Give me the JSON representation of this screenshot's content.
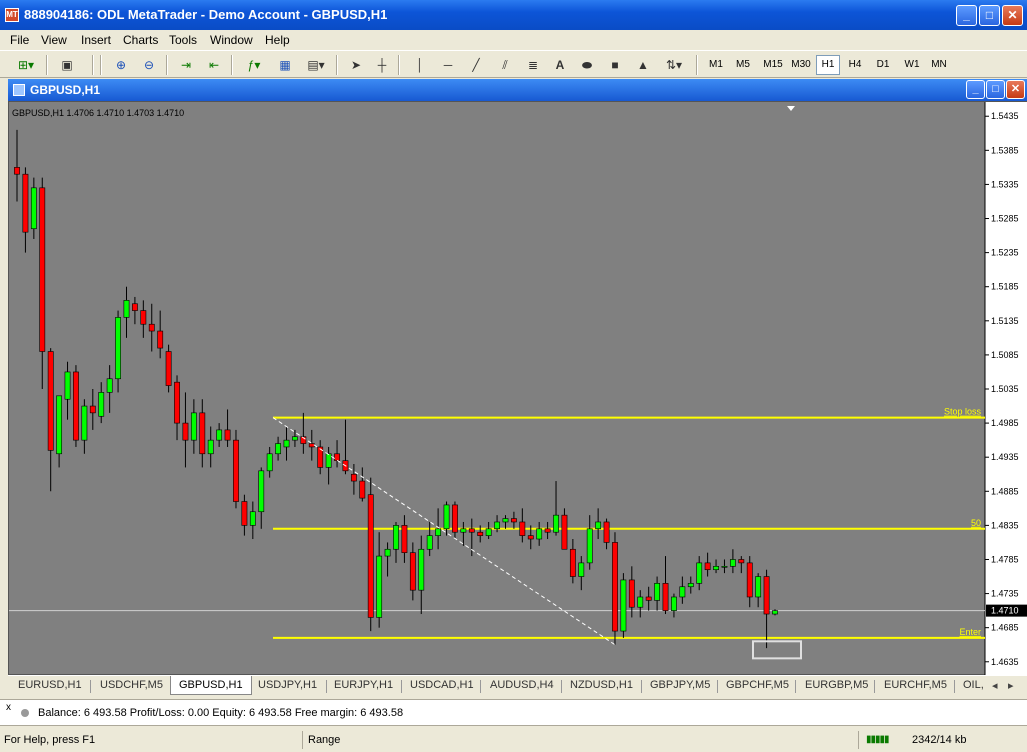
{
  "window": {
    "title": "888904186: ODL MetaTrader - Demo Account - GBPUSD,H1",
    "app_icon": "metatrader-icon"
  },
  "menu": [
    "File",
    "View",
    "Insert",
    "Charts",
    "Tools",
    "Window",
    "Help"
  ],
  "toolbar": {
    "timeframes": [
      "M1",
      "M5",
      "M15",
      "M30",
      "H1",
      "H4",
      "D1",
      "W1",
      "MN"
    ],
    "active_timeframe": "H1",
    "text_tool": "A"
  },
  "chart_window": {
    "title": "GBPUSD,H1"
  },
  "chart_info": "GBPUSD,H1  1.4706 1.4710 1.4703 1.4710",
  "chart_data": {
    "type": "candlestick",
    "symbol": "GBPUSD",
    "timeframe": "H1",
    "ylim": [
      1.462,
      1.545
    ],
    "yticks": [
      1.5435,
      1.5385,
      1.5335,
      1.5285,
      1.5235,
      1.5185,
      1.5135,
      1.5085,
      1.5035,
      1.4985,
      1.4935,
      1.4885,
      1.4835,
      1.4785,
      1.4735,
      1.4685,
      1.4635
    ],
    "current_price": "1.4710",
    "colors": {
      "background": "#808080",
      "bull": "#00ff00",
      "bear": "#ff0000",
      "wick": "#000000",
      "level": "#ffff00",
      "axis": "#000000"
    },
    "levels": [
      {
        "label": "Stop loss",
        "price": 1.4993
      },
      {
        "label": "50",
        "price": 1.483
      },
      {
        "label": "Enter",
        "price": 1.467
      }
    ],
    "candles": [
      [
        1.536,
        1.5415,
        1.531,
        1.535
      ],
      [
        1.535,
        1.536,
        1.5235,
        1.5265
      ],
      [
        1.527,
        1.5345,
        1.5255,
        1.533
      ],
      [
        1.533,
        1.5345,
        1.5035,
        1.509
      ],
      [
        1.509,
        1.5095,
        1.4885,
        1.4945
      ],
      [
        1.494,
        1.5025,
        1.492,
        1.5025
      ],
      [
        1.502,
        1.5075,
        1.499,
        1.506
      ],
      [
        1.506,
        1.507,
        1.495,
        1.496
      ],
      [
        1.496,
        1.502,
        1.494,
        1.501
      ],
      [
        1.501,
        1.5035,
        1.4975,
        1.5
      ],
      [
        1.4995,
        1.5045,
        1.4985,
        1.503
      ],
      [
        1.503,
        1.507,
        1.5,
        1.505
      ],
      [
        1.505,
        1.515,
        1.503,
        1.514
      ],
      [
        1.514,
        1.5185,
        1.511,
        1.5165
      ],
      [
        1.516,
        1.517,
        1.513,
        1.515
      ],
      [
        1.515,
        1.5165,
        1.511,
        1.513
      ],
      [
        1.513,
        1.516,
        1.509,
        1.512
      ],
      [
        1.512,
        1.515,
        1.508,
        1.5095
      ],
      [
        1.509,
        1.51,
        1.503,
        1.504
      ],
      [
        1.5045,
        1.5055,
        1.496,
        1.4985
      ],
      [
        1.4985,
        1.503,
        1.492,
        1.496
      ],
      [
        1.496,
        1.502,
        1.494,
        1.5
      ],
      [
        1.5,
        1.502,
        1.492,
        1.494
      ],
      [
        1.494,
        1.498,
        1.492,
        1.496
      ],
      [
        1.496,
        1.4985,
        1.495,
        1.4975
      ],
      [
        1.4975,
        1.5005,
        1.495,
        1.496
      ],
      [
        1.496,
        1.4975,
        1.486,
        1.487
      ],
      [
        1.487,
        1.488,
        1.482,
        1.4835
      ],
      [
        1.4835,
        1.487,
        1.4815,
        1.4855
      ],
      [
        1.4855,
        1.492,
        1.483,
        1.4915
      ],
      [
        1.4915,
        1.495,
        1.4905,
        1.494
      ],
      [
        1.494,
        1.4965,
        1.493,
        1.4955
      ],
      [
        1.495,
        1.498,
        1.493,
        1.496
      ],
      [
        1.496,
        1.4975,
        1.495,
        1.4965
      ],
      [
        1.4965,
        1.5,
        1.494,
        1.4955
      ],
      [
        1.4955,
        1.4975,
        1.493,
        1.495
      ],
      [
        1.495,
        1.496,
        1.491,
        1.492
      ],
      [
        1.492,
        1.495,
        1.4895,
        1.494
      ],
      [
        1.494,
        1.496,
        1.492,
        1.493
      ],
      [
        1.493,
        1.499,
        1.491,
        1.4915
      ],
      [
        1.491,
        1.4925,
        1.488,
        1.49
      ],
      [
        1.49,
        1.492,
        1.487,
        1.4875
      ],
      [
        1.488,
        1.4905,
        1.468,
        1.47
      ],
      [
        1.47,
        1.4825,
        1.4685,
        1.479
      ],
      [
        1.479,
        1.481,
        1.476,
        1.48
      ],
      [
        1.48,
        1.484,
        1.478,
        1.4835
      ],
      [
        1.4835,
        1.485,
        1.478,
        1.4795
      ],
      [
        1.4795,
        1.481,
        1.4725,
        1.474
      ],
      [
        1.474,
        1.482,
        1.4705,
        1.48
      ],
      [
        1.48,
        1.484,
        1.479,
        1.482
      ],
      [
        1.482,
        1.486,
        1.48,
        1.483
      ],
      [
        1.483,
        1.487,
        1.482,
        1.4865
      ],
      [
        1.4865,
        1.487,
        1.4815,
        1.4825
      ],
      [
        1.4825,
        1.484,
        1.4805,
        1.483
      ],
      [
        1.483,
        1.4845,
        1.479,
        1.4825
      ],
      [
        1.4825,
        1.4835,
        1.481,
        1.482
      ],
      [
        1.482,
        1.484,
        1.4815,
        1.483
      ],
      [
        1.483,
        1.485,
        1.4825,
        1.484
      ],
      [
        1.484,
        1.485,
        1.483,
        1.4845
      ],
      [
        1.4845,
        1.4855,
        1.483,
        1.484
      ],
      [
        1.484,
        1.486,
        1.481,
        1.482
      ],
      [
        1.482,
        1.4835,
        1.48,
        1.4815
      ],
      [
        1.4815,
        1.484,
        1.4805,
        1.483
      ],
      [
        1.483,
        1.484,
        1.4815,
        1.4825
      ],
      [
        1.4825,
        1.49,
        1.482,
        1.485
      ],
      [
        1.485,
        1.486,
        1.48,
        1.48
      ],
      [
        1.48,
        1.4815,
        1.475,
        1.476
      ],
      [
        1.476,
        1.479,
        1.474,
        1.478
      ],
      [
        1.478,
        1.485,
        1.477,
        1.483
      ],
      [
        1.483,
        1.486,
        1.4815,
        1.484
      ],
      [
        1.484,
        1.4845,
        1.48,
        1.481
      ],
      [
        1.481,
        1.4825,
        1.466,
        1.468
      ],
      [
        1.468,
        1.4765,
        1.467,
        1.4755
      ],
      [
        1.4755,
        1.4775,
        1.47,
        1.4715
      ],
      [
        1.4715,
        1.474,
        1.47,
        1.473
      ],
      [
        1.473,
        1.4745,
        1.471,
        1.4725
      ],
      [
        1.4725,
        1.476,
        1.471,
        1.475
      ],
      [
        1.475,
        1.479,
        1.4705,
        1.471
      ],
      [
        1.471,
        1.4735,
        1.47,
        1.473
      ],
      [
        1.473,
        1.476,
        1.472,
        1.4745
      ],
      [
        1.4745,
        1.476,
        1.4735,
        1.475
      ],
      [
        1.475,
        1.479,
        1.474,
        1.478
      ],
      [
        1.478,
        1.4795,
        1.476,
        1.477
      ],
      [
        1.477,
        1.4785,
        1.4765,
        1.4775
      ],
      [
        1.4775,
        1.4785,
        1.4765,
        1.4775
      ],
      [
        1.4775,
        1.48,
        1.4765,
        1.4785
      ],
      [
        1.4785,
        1.479,
        1.4765,
        1.478
      ],
      [
        1.478,
        1.479,
        1.4715,
        1.473
      ],
      [
        1.473,
        1.4765,
        1.4715,
        1.476
      ],
      [
        1.476,
        1.477,
        1.4655,
        1.4705
      ],
      [
        1.4705,
        1.4712,
        1.4703,
        1.471
      ]
    ]
  },
  "tabs": [
    "EURUSD,H1",
    "USDCHF,M5",
    "GBPUSD,H1",
    "USDJPY,H1",
    "EURJPY,H1",
    "USDCAD,H1",
    "AUDUSD,H4",
    "NZDUSD,H1",
    "GBPJPY,M5",
    "GBPCHF,M5",
    "EURGBP,M5",
    "EURCHF,M5",
    "OIL,"
  ],
  "active_tab": "GBPUSD,H1",
  "account": {
    "close_glyph": "x",
    "text": "Balance: 6 493.58  Profit/Loss: 0.00  Equity: 6 493.58  Free margin: 6 493.58"
  },
  "status": {
    "help": "For Help, press F1",
    "mode": "Range",
    "traffic": "2342/14 kb"
  }
}
